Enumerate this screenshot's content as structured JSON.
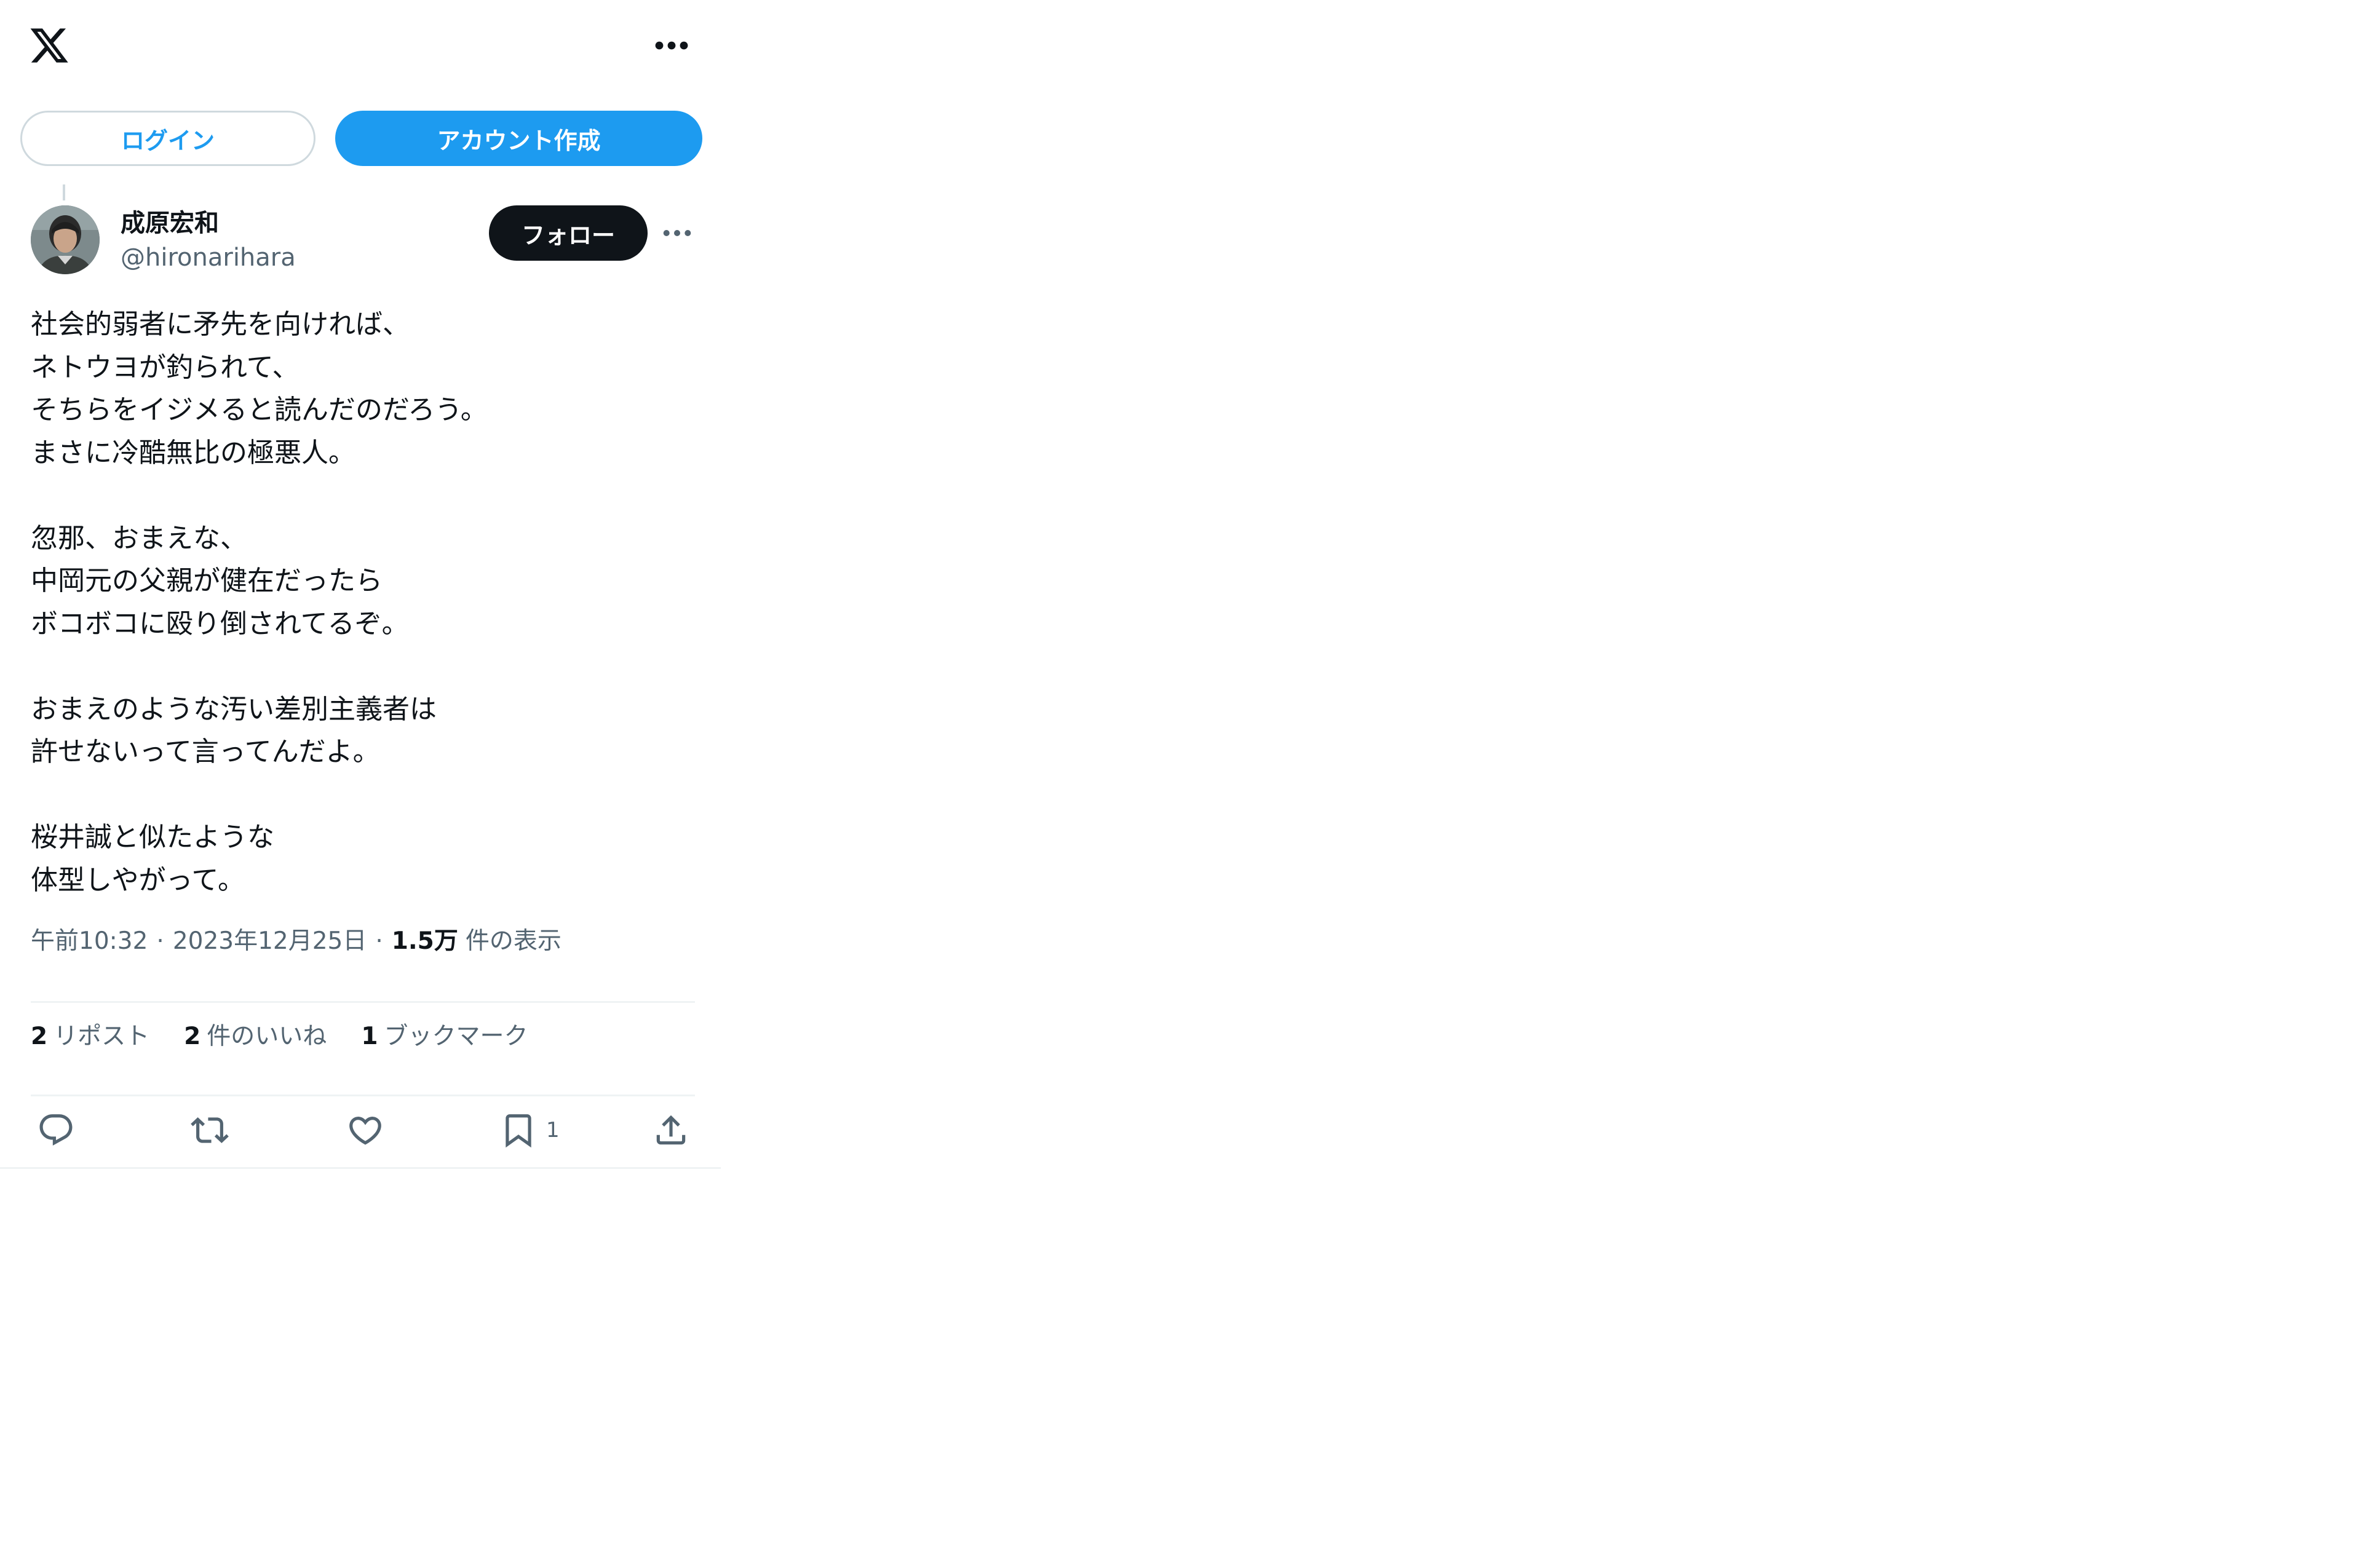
{
  "header": {
    "logo_icon": "x-logo-icon",
    "more_icon": "more-horizontal-icon"
  },
  "auth": {
    "login_label": "ログイン",
    "signup_label": "アカウント作成"
  },
  "tweet": {
    "author": {
      "display_name": "成原宏和",
      "handle": "@hironarihara"
    },
    "follow_label": "フォロー",
    "text": "社会的弱者に矛先を向ければ、\nネトウヨが釣られて、\nそちらをイジメると読んだのだろう。\nまさに冷酷無比の極悪人。\n\n忽那、おまえな、\n中岡元の父親が健在だったら\nボコボコに殴り倒されてるぞ。\n\nおまえのような汚い差別主義者は\n許せないって言ってんだよ。\n\n桜井誠と似たような\n体型しやがって。",
    "time": "午前10:32",
    "date": "2023年12月25日",
    "views_count": "1.5万",
    "views_label": "件の表示",
    "stats": {
      "reposts_count": "2",
      "reposts_label": "リポスト",
      "likes_count": "2",
      "likes_label": "件のいいね",
      "bookmarks_count": "1",
      "bookmarks_label": "ブックマーク"
    },
    "actions": {
      "bookmark_count": "1"
    }
  },
  "colors": {
    "accent": "#1d9bf0",
    "text_primary": "#0f1419",
    "text_secondary": "#536471",
    "border": "#eff3f4"
  }
}
